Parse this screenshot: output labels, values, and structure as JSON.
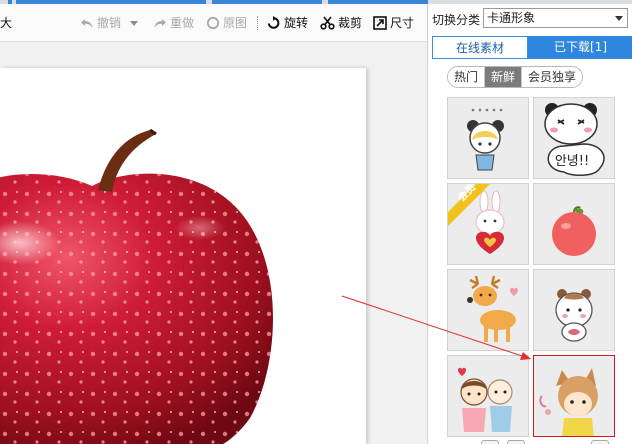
{
  "toolbar": {
    "left_fragment": "大",
    "undo_label": "撤销",
    "redo_label": "重做",
    "original_label": "原图",
    "rotate_label": "旋转",
    "crop_label": "裁剪",
    "size_label": "尺寸"
  },
  "panel": {
    "category_label": "切换分类",
    "category_value": "卡通形象",
    "tabs": [
      {
        "label": "在线素材"
      },
      {
        "label": "已下载[1]"
      }
    ],
    "filters": [
      {
        "label": "热门"
      },
      {
        "label": "新鲜"
      },
      {
        "label": "会员独享"
      }
    ],
    "selected_filter": "新鲜",
    "sticker_badge": "会员",
    "sticker_speech_text": "안녕!!"
  },
  "colors": {
    "accent_blue": "#2e86de",
    "selection_red": "#d21818",
    "arrow_red": "#e03030"
  },
  "icons": [
    "undo-icon",
    "dropdown-arrow-icon",
    "redo-icon",
    "original-icon",
    "rotate-icon",
    "crop-icon",
    "resize-icon"
  ]
}
